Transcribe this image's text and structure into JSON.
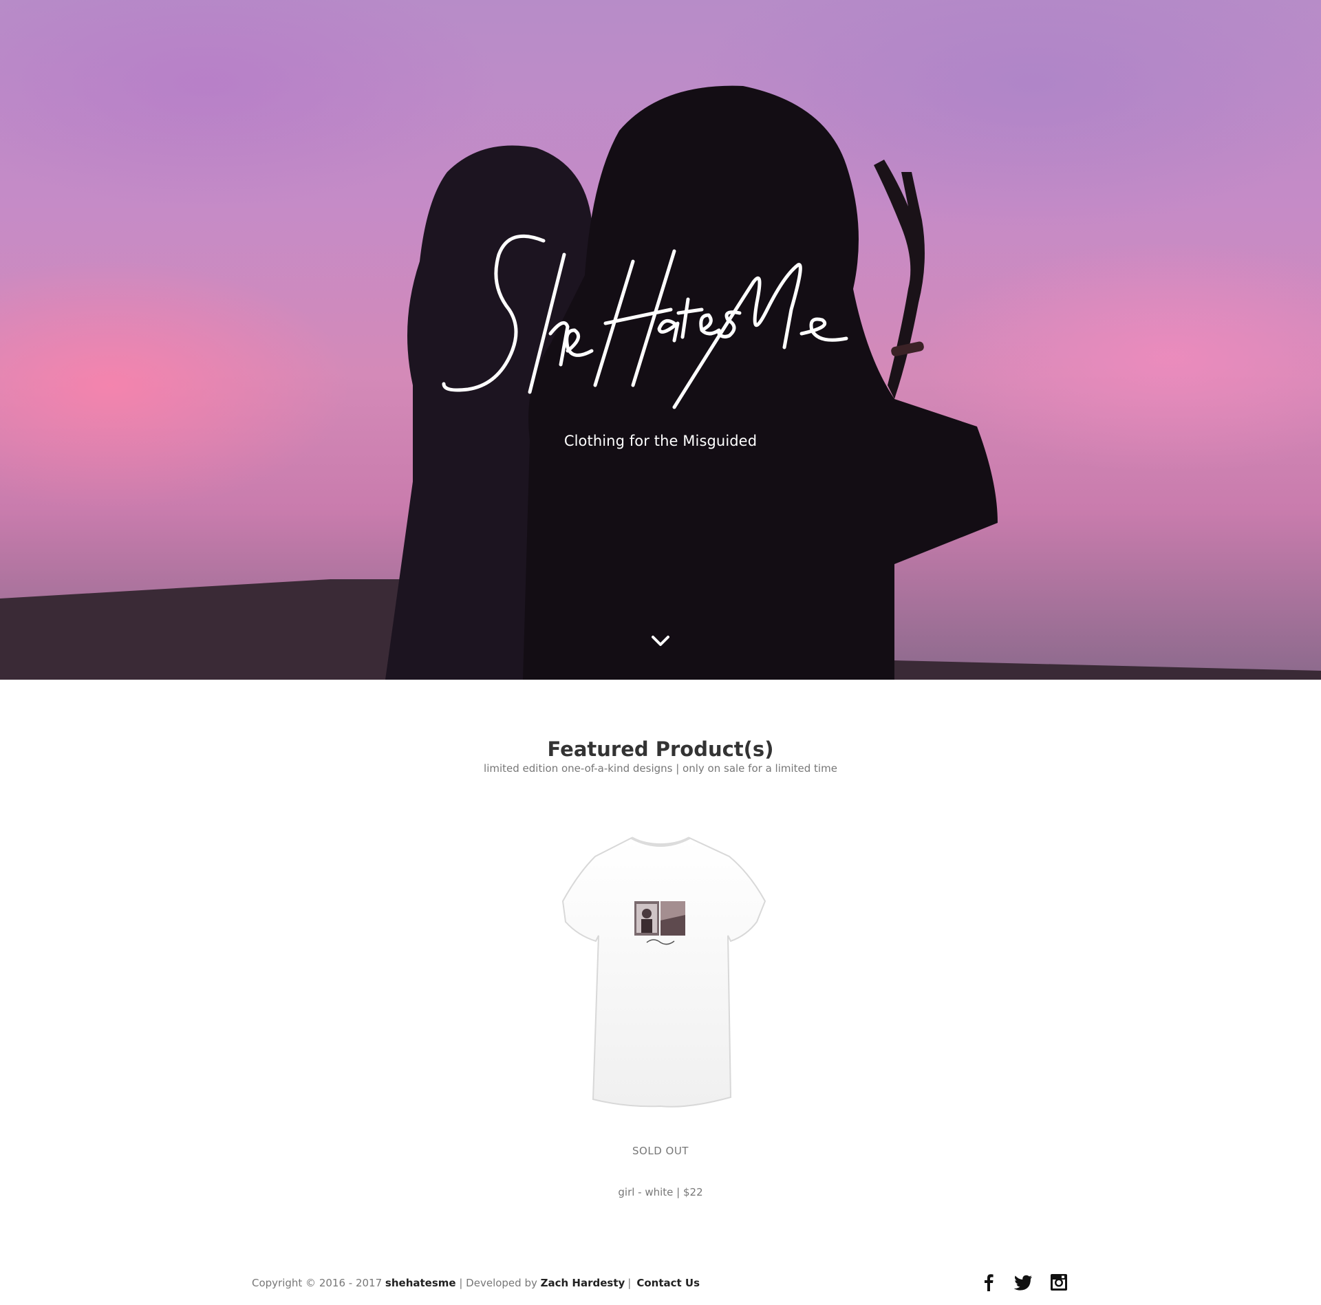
{
  "hero": {
    "logo_text": "SheHatesMe",
    "tagline": "Clothing for the Misguided",
    "scroll_icon": "chevron-down-icon"
  },
  "featured": {
    "title": "Featured Product(s)",
    "subtitle": "limited edition one-of-a-kind designs | only on sale for a limited time",
    "product": {
      "status": "SOLD OUT",
      "info": "girl - white | $22"
    }
  },
  "footer": {
    "copyright": "Copyright © 2016 - 2017",
    "brand": "shehatesme",
    "developed_by_label": "| Developed by",
    "developer": "Zach Hardesty",
    "separator": "|",
    "contact": "Contact Us",
    "social": [
      "facebook-icon",
      "twitter-icon",
      "instagram-icon"
    ]
  }
}
